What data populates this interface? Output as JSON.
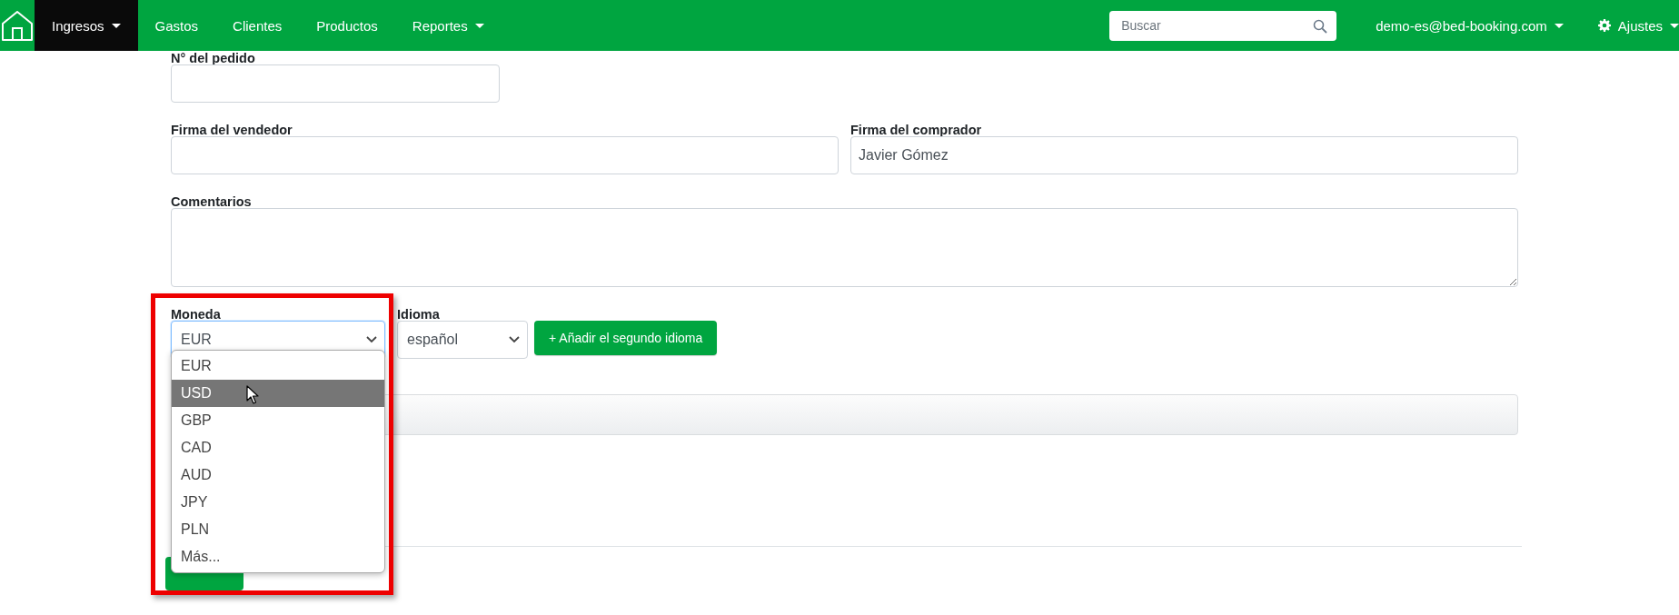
{
  "navbar": {
    "items": [
      {
        "label": "Ingresos",
        "selected": true,
        "caret": true
      },
      {
        "label": "Gastos",
        "selected": false,
        "caret": false
      },
      {
        "label": "Clientes",
        "selected": false,
        "caret": false
      },
      {
        "label": "Productos",
        "selected": false,
        "caret": false
      },
      {
        "label": "Reportes",
        "selected": false,
        "caret": true
      }
    ],
    "search": {
      "placeholder": "Buscar"
    },
    "user": {
      "label": "demo-es@bed-booking.com"
    },
    "settings": {
      "label": "Ajustes"
    }
  },
  "form": {
    "order_number": {
      "label": "N° del pedido"
    },
    "seller_signature": {
      "label": "Firma del vendedor"
    },
    "buyer_signature": {
      "label": "Firma del comprador",
      "value": "Javier Gómez"
    },
    "comments": {
      "label": "Comentarios"
    },
    "currency": {
      "label": "Moneda",
      "value": "EUR",
      "open": true,
      "options": [
        {
          "label": "EUR",
          "highlighted": false
        },
        {
          "label": "USD",
          "highlighted": true
        },
        {
          "label": "GBP",
          "highlighted": false
        },
        {
          "label": "CAD",
          "highlighted": false
        },
        {
          "label": "AUD",
          "highlighted": false
        },
        {
          "label": "JPY",
          "highlighted": false
        },
        {
          "label": "PLN",
          "highlighted": false
        },
        {
          "label": "Más...",
          "highlighted": false
        }
      ]
    },
    "language": {
      "label": "Idioma",
      "value": "español"
    },
    "add_language_button": {
      "label": "+ Añadir el segundo idioma"
    }
  }
}
